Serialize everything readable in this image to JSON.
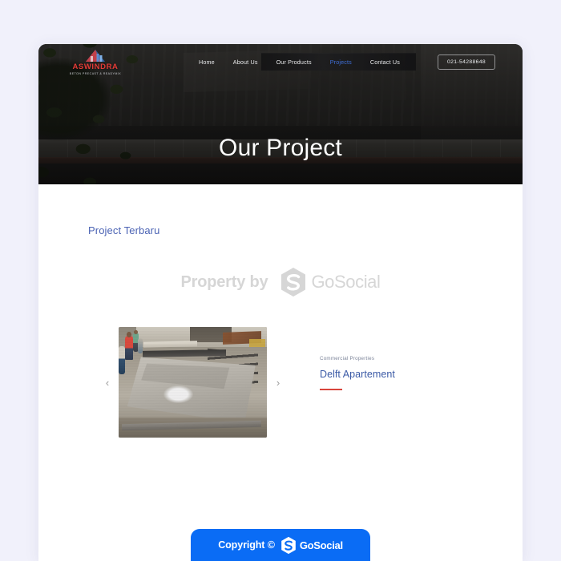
{
  "site": {
    "brand_name": "ASWINDRA",
    "brand_tagline": "BETON PRECAST & READYMIX",
    "brand_logo_icon": "house-building-icon"
  },
  "nav": {
    "items": [
      {
        "label": "Home",
        "active": false
      },
      {
        "label": "About Us",
        "active": false
      },
      {
        "label": "Our Products",
        "active": false
      },
      {
        "label": "Projects",
        "active": true
      },
      {
        "label": "Contact Us",
        "active": false
      }
    ],
    "phone": "021-54288648"
  },
  "hero": {
    "title": "Our Project"
  },
  "main": {
    "section_title": "Project Terbaru",
    "watermark": {
      "prefix": "Property by",
      "logo_icon": "gosocial-hexagon-icon",
      "brand": "GoSocial"
    },
    "carousel": {
      "prev_icon": "chevron-left-icon",
      "next_icon": "chevron-right-icon",
      "slide": {
        "image_alt": "concrete-slab-construction-site",
        "category": "Commercial Properties",
        "title": "Delft Apartement"
      }
    }
  },
  "footer": {
    "copyright_text": "Copyright ©",
    "logo_icon": "gosocial-hexagon-icon",
    "brand": "GoSocial"
  },
  "colors": {
    "page_background": "#f1f1fb",
    "accent_blue": "#0a6cf5",
    "heading_blue": "#4b63b4",
    "title_blue": "#3b5aa6",
    "rule_red": "#d9443b",
    "brand_red": "#e23b37",
    "nav_active": "#3f6fd8",
    "watermark_gray": "#d6d6d6"
  }
}
